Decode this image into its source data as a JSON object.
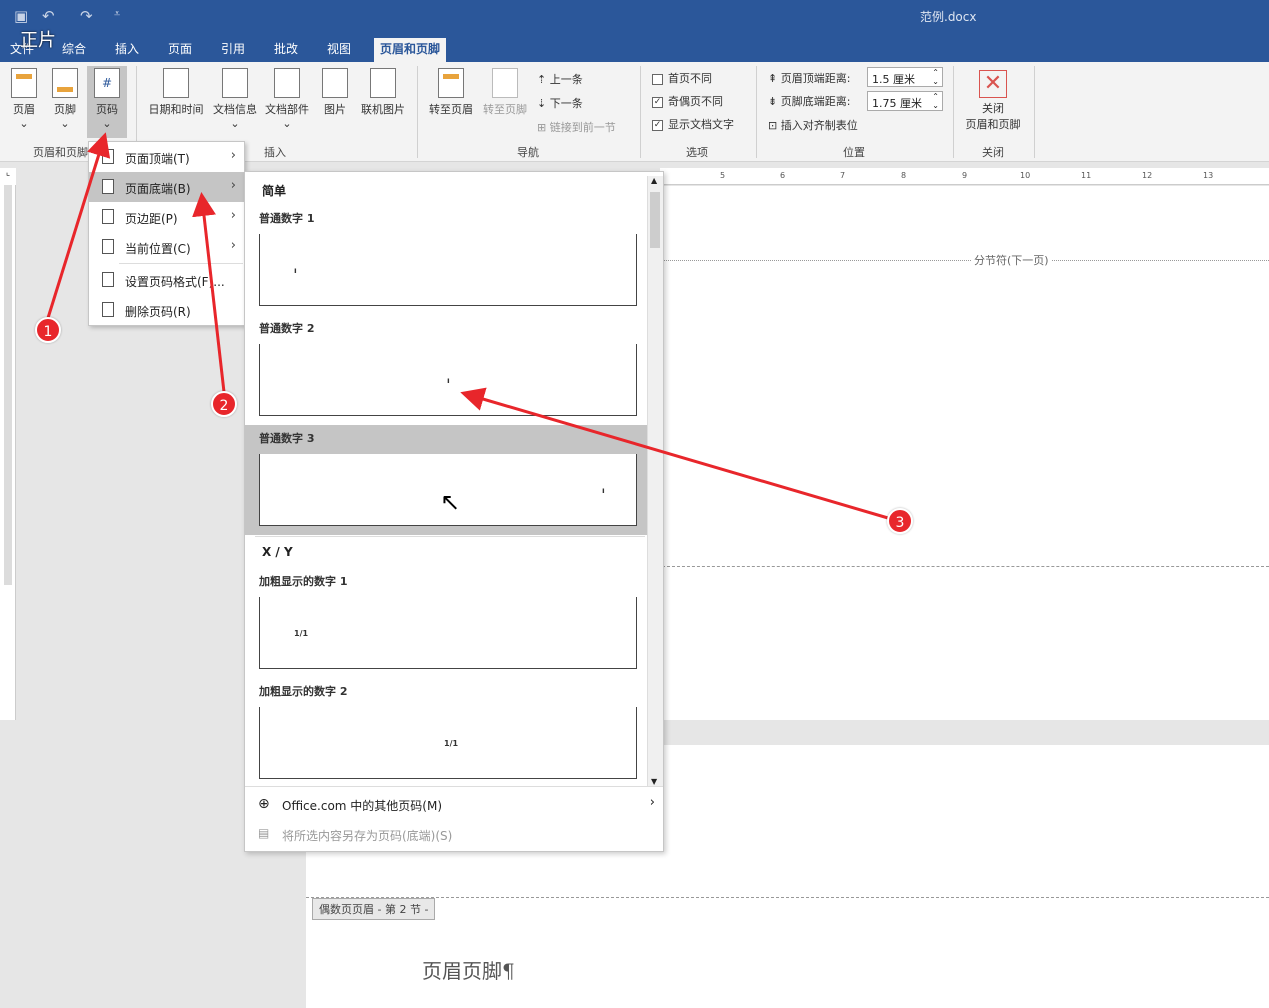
{
  "window": {
    "title": "范例.docx",
    "watermark": "正片"
  },
  "tabs": [
    "文件",
    "综合",
    "插入",
    "页面",
    "引用",
    "批改",
    "视图",
    "页眉和页脚"
  ],
  "ribbon": {
    "group1": {
      "label": "页眉和页脚",
      "buttons": [
        "页眉",
        "页脚",
        "页码"
      ]
    },
    "group2": {
      "label": "插入",
      "buttons": [
        "日期和时间",
        "文档信息",
        "文档部件",
        "图片",
        "联机图片"
      ]
    },
    "group3": {
      "label": "导航",
      "goto_header": "转至页眉",
      "goto_footer": "转至页脚",
      "prev": "上一条",
      "next": "下一条",
      "link_prev": "链接到前一节"
    },
    "group4": {
      "label": "选项",
      "first_diff": "首页不同",
      "odd_even_diff": "奇偶页不同",
      "show_doc_text": "显示文档文字"
    },
    "group5": {
      "label": "位置",
      "header_dist_label": "页眉顶端距离:",
      "header_dist_value": "1.5 厘米",
      "footer_dist_label": "页脚底端距离:",
      "footer_dist_value": "1.75 厘米",
      "insert_align_tab": "插入对齐制表位"
    },
    "group6": {
      "label": "关闭",
      "close_line1": "关闭",
      "close_line2": "页眉和页脚"
    }
  },
  "options_state": {
    "first_diff": false,
    "odd_even_diff": true,
    "show_doc_text": true
  },
  "menu": {
    "items": [
      "页面顶端(T)",
      "页面底端(B)",
      "页边距(P)",
      "当前位置(C)",
      "设置页码格式(F)...",
      "删除页码(R)"
    ],
    "hovered": "页面底端(B)"
  },
  "gallery": {
    "section1": "简单",
    "section2": "X / Y",
    "items": [
      "普通数字 1",
      "普通数字 2",
      "普通数字 3",
      "加粗显示的数字 1",
      "加粗显示的数字 2"
    ],
    "selected": "普通数字 3",
    "thumb_glyphs": [
      "ı",
      "ı",
      "ı",
      "1/1",
      "1/1"
    ],
    "more": "Office.com 中的其他页码(M)",
    "save_selection": "将所选内容另存为页码(底端)(S)"
  },
  "document": {
    "section_break": "分节符(下一页)",
    "even_header_tag": "偶数页页眉 - 第 2 节 -",
    "body_text": "页眉页脚¶"
  },
  "ruler_ticks": [
    "5",
    "6",
    "7",
    "8",
    "9",
    "10",
    "11",
    "12",
    "13"
  ],
  "annotations": [
    "1",
    "2",
    "3"
  ],
  "colors": {
    "accent": "#2b579a",
    "marker": "#e8262b",
    "highlight": "#c5c5c5"
  }
}
